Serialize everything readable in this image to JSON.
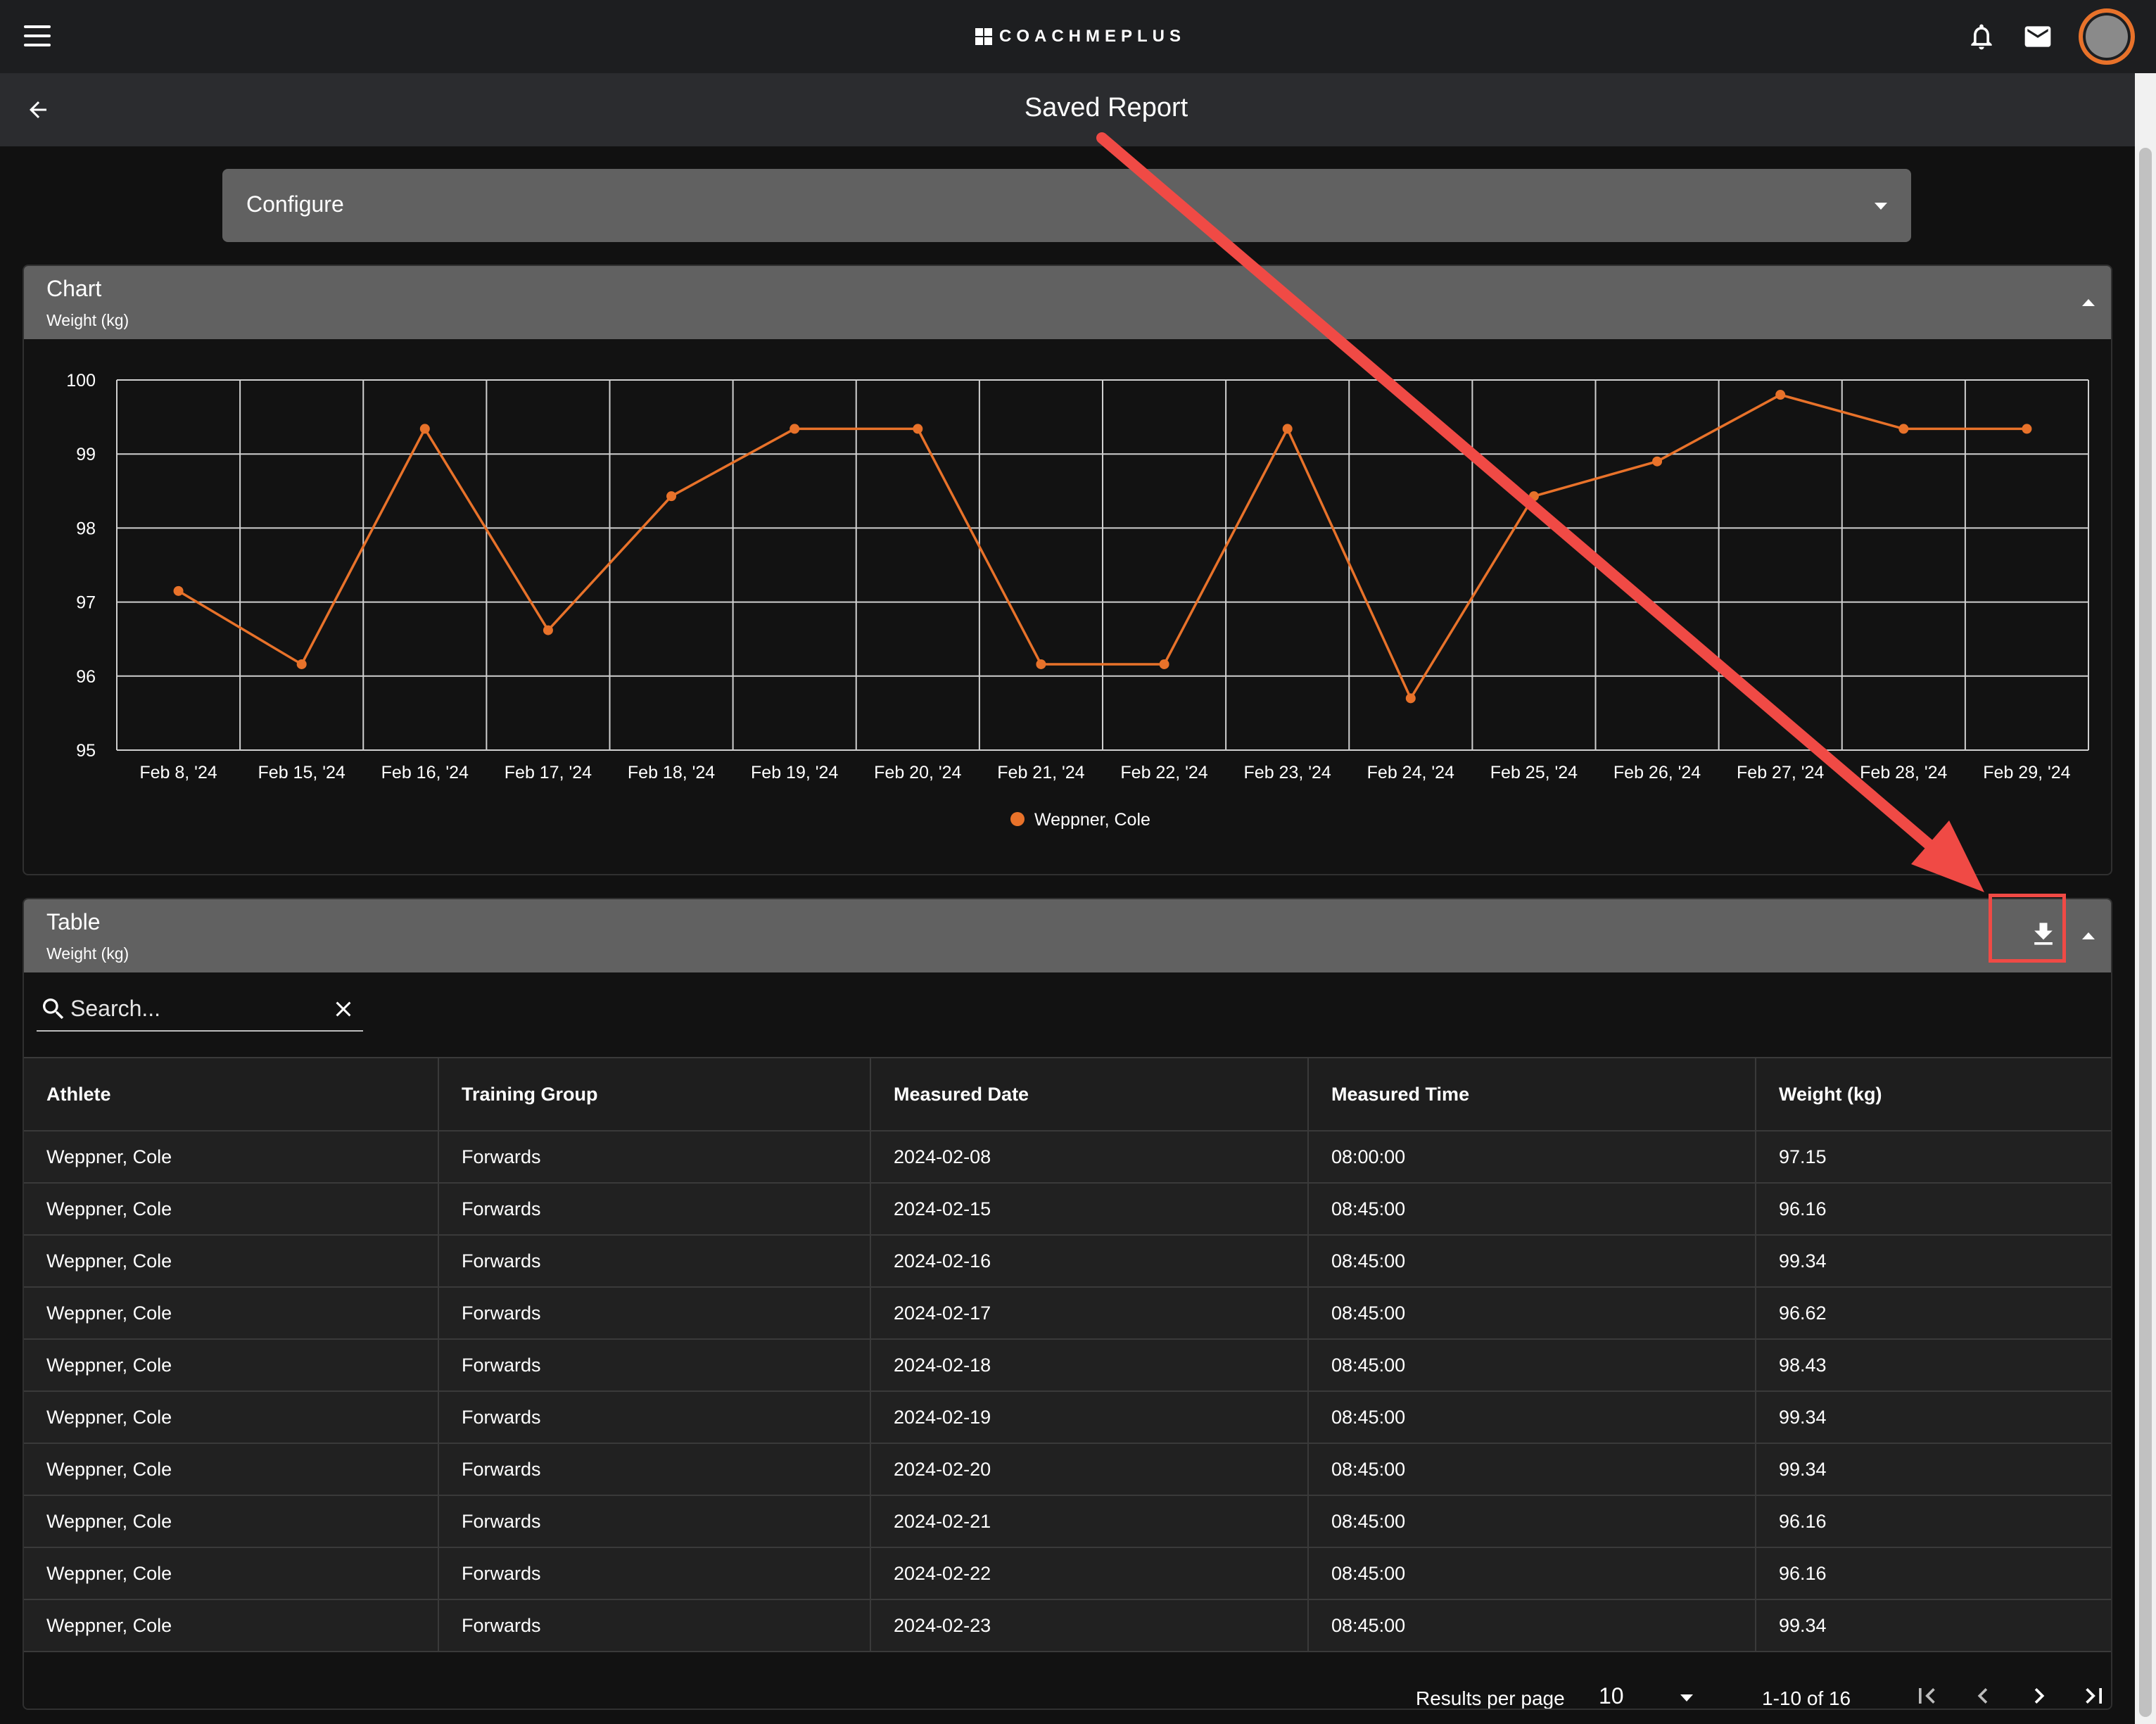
{
  "app": {
    "brand": "COACHMEPLUS",
    "icons": [
      "menu-icon",
      "bell-icon",
      "mail-icon",
      "avatar"
    ]
  },
  "page": {
    "title": "Saved Report"
  },
  "configure": {
    "label": "Configure"
  },
  "chart_panel": {
    "title": "Chart",
    "subtitle": "Weight (kg)"
  },
  "table_panel": {
    "title": "Table",
    "subtitle": "Weight (kg)"
  },
  "search": {
    "placeholder": "Search..."
  },
  "table": {
    "columns": [
      "Athlete",
      "Training Group",
      "Measured Date",
      "Measured Time",
      "Weight (kg)"
    ],
    "rows": [
      [
        "Weppner, Cole",
        "Forwards",
        "2024-02-08",
        "08:00:00",
        "97.15"
      ],
      [
        "Weppner, Cole",
        "Forwards",
        "2024-02-15",
        "08:45:00",
        "96.16"
      ],
      [
        "Weppner, Cole",
        "Forwards",
        "2024-02-16",
        "08:45:00",
        "99.34"
      ],
      [
        "Weppner, Cole",
        "Forwards",
        "2024-02-17",
        "08:45:00",
        "96.62"
      ],
      [
        "Weppner, Cole",
        "Forwards",
        "2024-02-18",
        "08:45:00",
        "98.43"
      ],
      [
        "Weppner, Cole",
        "Forwards",
        "2024-02-19",
        "08:45:00",
        "99.34"
      ],
      [
        "Weppner, Cole",
        "Forwards",
        "2024-02-20",
        "08:45:00",
        "99.34"
      ],
      [
        "Weppner, Cole",
        "Forwards",
        "2024-02-21",
        "08:45:00",
        "96.16"
      ],
      [
        "Weppner, Cole",
        "Forwards",
        "2024-02-22",
        "08:45:00",
        "96.16"
      ],
      [
        "Weppner, Cole",
        "Forwards",
        "2024-02-23",
        "08:45:00",
        "99.34"
      ]
    ]
  },
  "pagination": {
    "results_label": "Results per page",
    "per_page": "10",
    "range": "1-10 of 16"
  },
  "colors": {
    "accent": "#e8722a",
    "annotation": "#f04a45",
    "panel_header": "#616161"
  },
  "chart_data": {
    "type": "line",
    "categories": [
      "Feb 8, '24",
      "Feb 15, '24",
      "Feb 16, '24",
      "Feb 17, '24",
      "Feb 18, '24",
      "Feb 19, '24",
      "Feb 20, '24",
      "Feb 21, '24",
      "Feb 22, '24",
      "Feb 23, '24",
      "Feb 24, '24",
      "Feb 25, '24",
      "Feb 26, '24",
      "Feb 27, '24",
      "Feb 28, '24",
      "Feb 29, '24"
    ],
    "series": [
      {
        "name": "Weppner, Cole",
        "color": "#e8722a",
        "values": [
          97.15,
          96.16,
          99.34,
          96.62,
          98.43,
          99.34,
          99.34,
          96.16,
          96.16,
          99.34,
          95.7,
          98.43,
          98.9,
          99.8,
          99.34,
          99.34
        ]
      }
    ],
    "y_ticks": [
      "95",
      "96",
      "97",
      "98",
      "99",
      "100"
    ],
    "ylim": [
      95,
      100
    ],
    "grid": true,
    "legend": "bottom-center"
  }
}
